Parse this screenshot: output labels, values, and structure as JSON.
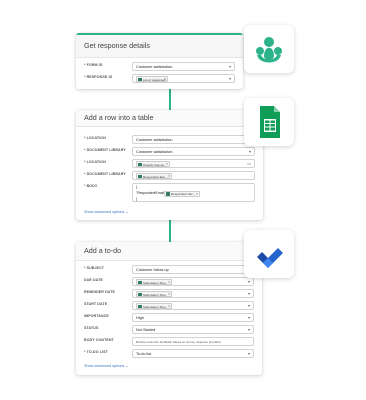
{
  "colors": {
    "accent": "#2db38a",
    "link": "#3b73c4",
    "sheets": "#0f9d58",
    "todo": "#2564cf"
  },
  "card1": {
    "title": "Get response details",
    "rows": [
      {
        "label": "* FORM ID",
        "value": "Customer satisfaction"
      },
      {
        "label": "* RESPONSE ID",
        "token": "List of responses"
      }
    ],
    "badge_icon": "surveymonkey-icon"
  },
  "card2": {
    "title": "Add a row into a table",
    "rows": [
      {
        "label": "* LOCATION",
        "value": "Customer satisfaction"
      },
      {
        "label": "* DOCUMENT LIBRARY",
        "value": "Customer satisfaction"
      },
      {
        "label": "* LOCATION",
        "token": "Overall, how sa..."
      },
      {
        "label": "* DOCUMENT LIBRARY",
        "token": "Respondent Eco..."
      },
      {
        "label": "* BODY",
        "body_open": "{",
        "body_key": "\"RespondentEmail\":",
        "token": "Respondent Ser...",
        "body_close": "}"
      }
    ],
    "advanced": "Show advanced options",
    "badge_icon": "google-sheets-icon"
  },
  "card3": {
    "title": "Add a to-do",
    "rows": [
      {
        "label": "* SUBJECT",
        "value": "Customer follow-up"
      },
      {
        "label": "DUE DATE",
        "token": "Submission Time"
      },
      {
        "label": "REMINDER DATE",
        "token": "Submission Time"
      },
      {
        "label": "START DATE",
        "token": "Submission Time"
      },
      {
        "label": "IMPORTANCE",
        "value": "High"
      },
      {
        "label": "STATUS",
        "value": "Not Started"
      },
      {
        "label": "BODY CONTENT",
        "value": "Review customer feedback based on survey response provided"
      },
      {
        "label": "* TO-DO LIST",
        "value": "To-do list"
      }
    ],
    "advanced": "Show advanced options",
    "badge_icon": "microsoft-todo-icon"
  }
}
